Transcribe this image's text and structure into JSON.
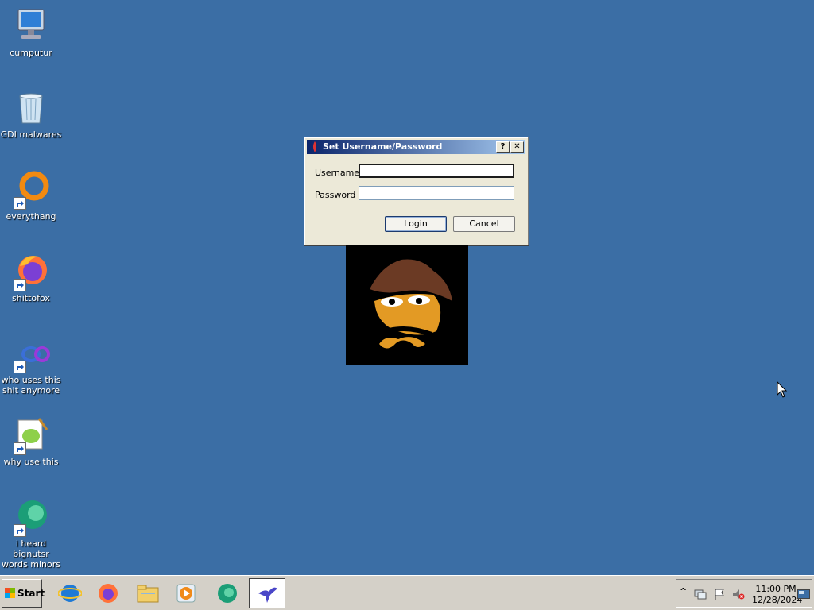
{
  "desktop": {
    "icons": [
      {
        "label": "cumputur",
        "icon": "computer-icon"
      },
      {
        "label": "GDI malwares",
        "icon": "recycle-bin-icon"
      },
      {
        "label": "everythang",
        "icon": "everything-search-icon"
      },
      {
        "label": "shittofox",
        "icon": "firefox-icon"
      },
      {
        "label": "who uses this shit anymore",
        "icon": "internet-explorer-icon"
      },
      {
        "label": "why use this",
        "icon": "notepad-plus-plus-icon"
      },
      {
        "label": "i heard bignutsr words minors",
        "icon": "edge-icon"
      }
    ]
  },
  "dialog": {
    "title": "Set Username/Password",
    "help_button": "?",
    "close_button": "✕",
    "username_label": "Username",
    "username_value": "",
    "password_label": "Password",
    "password_value": "",
    "login_label": "Login",
    "cancel_label": "Cancel"
  },
  "taskbar": {
    "start_label": "Start",
    "apps": [
      "internet-explorer-icon",
      "firefox-icon",
      "file-explorer-icon",
      "media-player-icon",
      "edge-icon",
      "app-bird-icon"
    ],
    "tray": {
      "chevron": "^",
      "time": "11:00 PM",
      "date": "12/28/2024"
    }
  },
  "colors": {
    "desktop": "#3b6ea5",
    "title_gradient_start": "#0a246a",
    "title_gradient_end": "#a6caf0",
    "taskbar": "#d4d0c8"
  }
}
